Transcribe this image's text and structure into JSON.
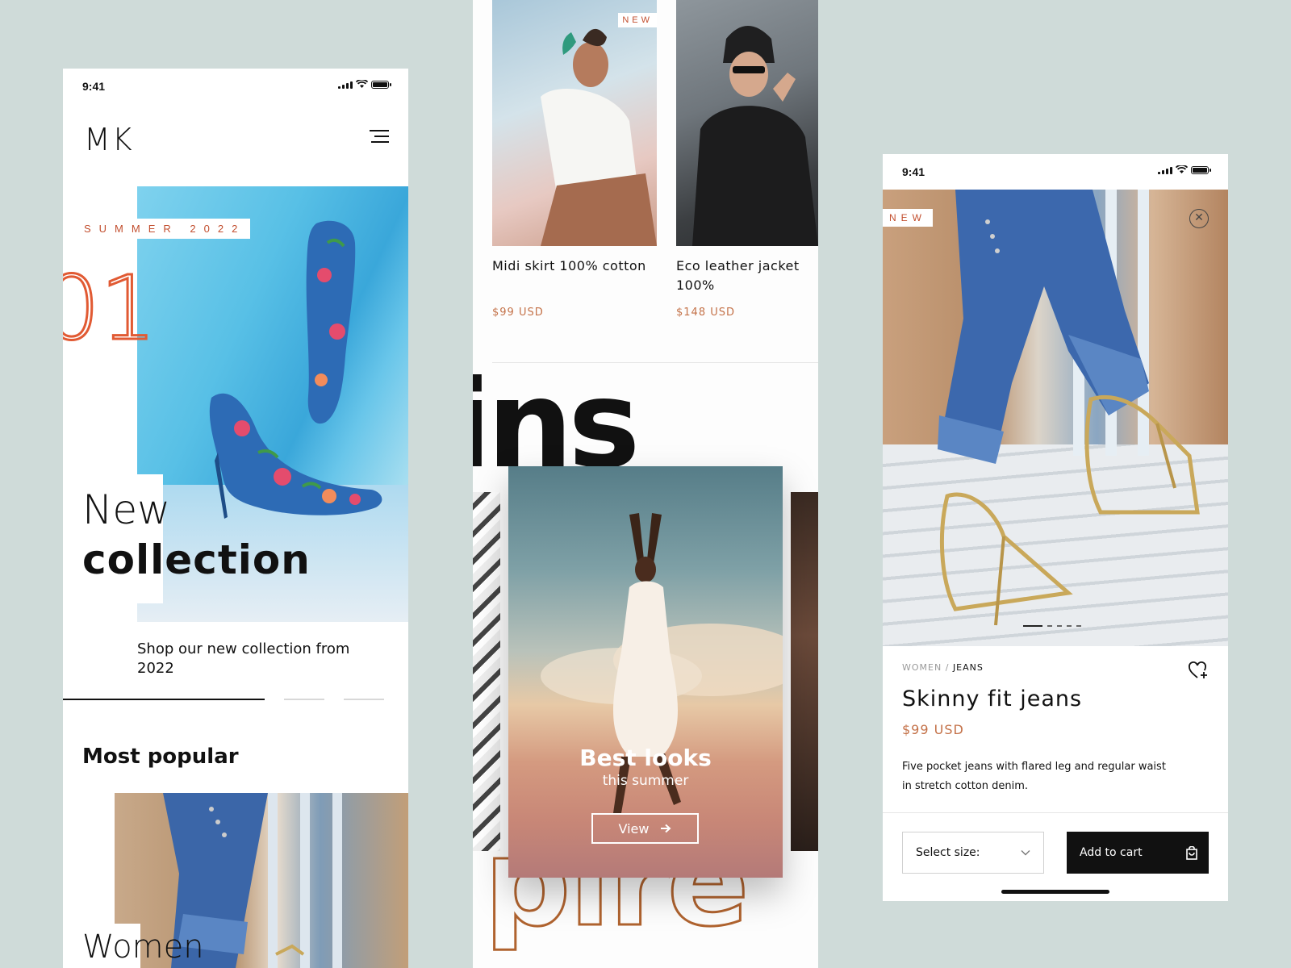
{
  "screen1": {
    "time": "9:41",
    "logo": "MK",
    "hero_tag": "SUMMER 2022",
    "hero_number": "01",
    "title_line1": "New",
    "title_line2": "collection",
    "subtitle": "Shop our new collection from 2022",
    "section_title": "Most popular",
    "category_label": "Women",
    "carousel_progress": {
      "active": 1,
      "total": 3
    }
  },
  "screen2": {
    "products": [
      {
        "name": "Midi skirt 100% cotton",
        "price": "$99 USD",
        "badge": "NEW"
      },
      {
        "name": "Eco leather jacket 100%",
        "price": "$148 USD"
      }
    ],
    "headline_top": "ins",
    "headline_bottom": "pire",
    "feature": {
      "title": "Best looks",
      "subtitle": "this summer",
      "button": "View"
    }
  },
  "screen3": {
    "time": "9:41",
    "badge": "NEW",
    "breadcrumb": {
      "parent": "WOMEN",
      "separator": "/",
      "current": "JEANS"
    },
    "title": "Skinny fit jeans",
    "price": "$99 USD",
    "description": "Five pocket jeans with flared leg and regular waist in stretch cotton denim.",
    "size_select": "Select size:",
    "add_to_cart": "Add to cart",
    "image_dots": {
      "active": 1,
      "total": 5
    }
  },
  "colors": {
    "background": "#cfdbd9",
    "accent": "#e15a33",
    "price": "#c47249",
    "dark": "#111111"
  }
}
